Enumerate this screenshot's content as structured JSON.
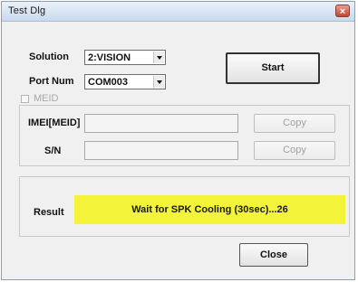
{
  "window": {
    "title": "Test Dlg",
    "close_glyph": "×"
  },
  "form": {
    "solution_label": "Solution",
    "solution_value": "2:VISION",
    "port_label": "Port Num",
    "port_value": "COM003",
    "meid_checkbox_label": "MEID",
    "meid_checked": false,
    "imei_label": "IMEI[MEID]",
    "imei_value": "",
    "sn_label": "S/N",
    "sn_value": ""
  },
  "buttons": {
    "start": "Start",
    "copy_imei": "Copy",
    "copy_sn": "Copy",
    "close": "Close"
  },
  "result": {
    "label": "Result",
    "message": "Wait for SPK Cooling (30sec)...26",
    "highlight_color": "#f3f33a"
  },
  "icons": {
    "combo_arrow": "chevron-down-icon",
    "close": "close-icon"
  }
}
